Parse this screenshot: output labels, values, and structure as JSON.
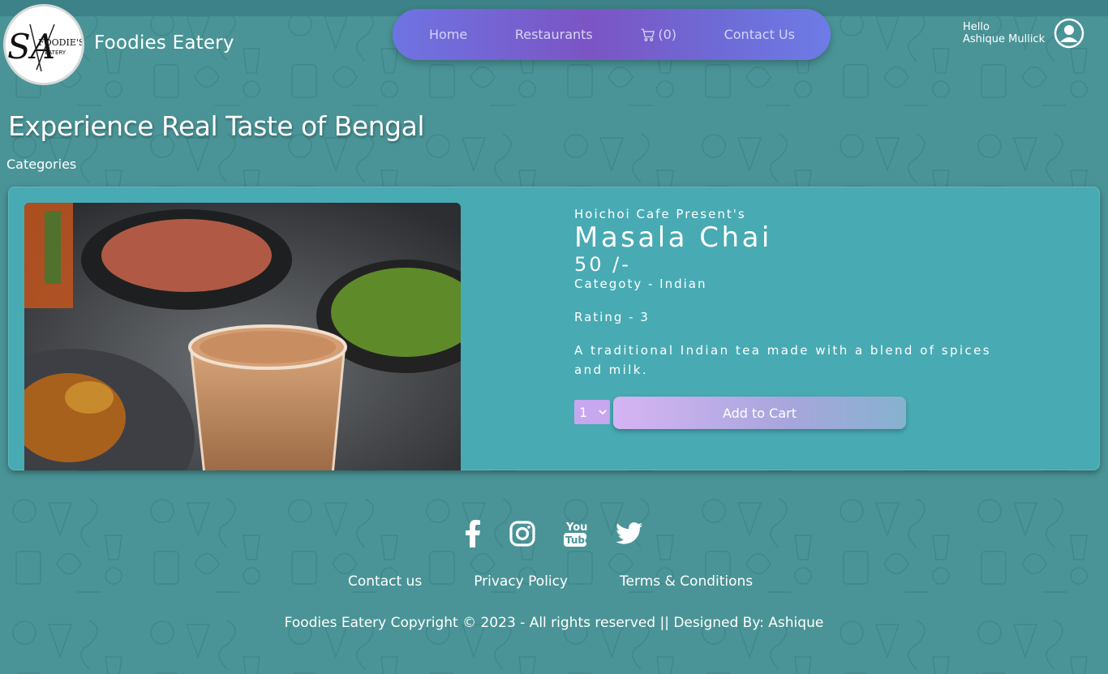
{
  "brand": {
    "logo_text": "SA FOODIE'S EATERY",
    "name": "Foodies Eatery"
  },
  "nav": {
    "items": [
      {
        "label": "Home",
        "icon": ""
      },
      {
        "label": "Restaurants",
        "icon": ""
      },
      {
        "label": "(0)",
        "icon": "cart-icon"
      },
      {
        "label": "Contact Us",
        "icon": ""
      }
    ]
  },
  "user": {
    "hello": "Hello",
    "name": "Ashique Mullick",
    "icon": "user-circle-icon"
  },
  "page": {
    "title": "Experience Real Taste of Bengal",
    "categories_label": "Categories"
  },
  "product": {
    "presents": "Hoichoi Cafe Present's",
    "name": "Masala Chai",
    "price": "50 /-",
    "category": "Categoty - Indian",
    "rating": "Rating - 3",
    "description": "A traditional Indian tea made with a blend of spices and milk.",
    "quantity": "1",
    "add_to_cart_label": "Add to Cart"
  },
  "footer": {
    "social_icons": [
      "facebook-icon",
      "instagram-icon",
      "youtube-icon",
      "twitter-icon"
    ],
    "links": [
      "Contact us",
      "Privacy Policy",
      "Terms & Conditions"
    ],
    "copyright": "Foodies Eatery Copyright © 2023 - All rights reserved || Designed By: Ashique"
  },
  "colors": {
    "background": "#4a9497",
    "card": "#48aab3",
    "nav_gradient_start": "#6e74e2",
    "nav_gradient_mid": "#7c54c4",
    "button_gradient_start": "#d6b4f4",
    "button_gradient_end": "#86b2cf"
  }
}
